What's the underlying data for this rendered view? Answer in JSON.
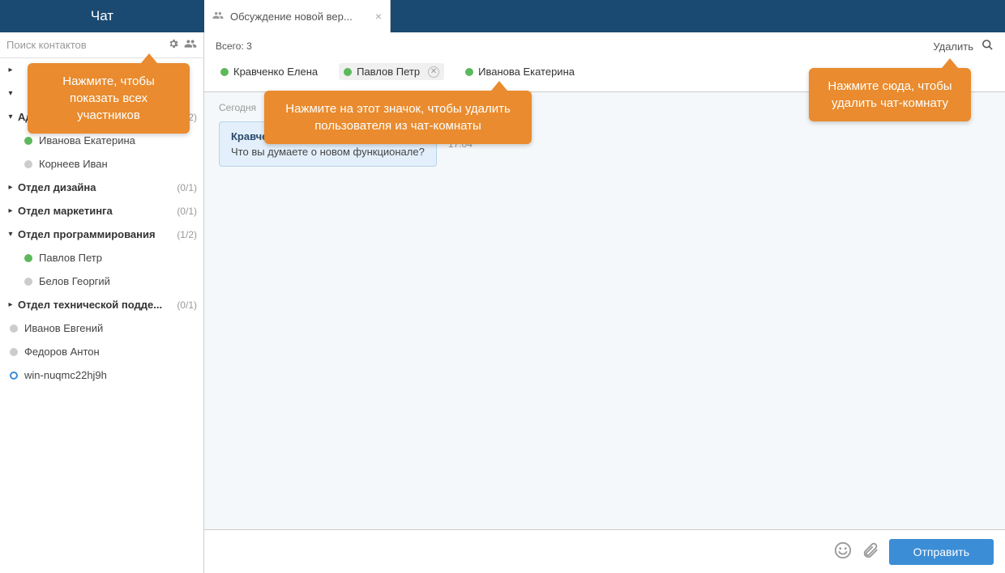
{
  "header": {
    "title": "Чат"
  },
  "tab": {
    "label": "Обсуждение новой вер..."
  },
  "search": {
    "placeholder": "Поиск контактов"
  },
  "tree": {
    "truncated_group": "...",
    "groups": [
      {
        "label": "Администрация",
        "count": "(1/2)",
        "expanded": true,
        "members": [
          {
            "name": "Иванова Екатерина",
            "status": "online"
          },
          {
            "name": "Корнеев Иван",
            "status": "offline"
          }
        ]
      },
      {
        "label": "Отдел дизайна",
        "count": "(0/1)",
        "expanded": false
      },
      {
        "label": "Отдел маркетинга",
        "count": "(0/1)",
        "expanded": false
      },
      {
        "label": "Отдел программирования",
        "count": "(1/2)",
        "expanded": true,
        "members": [
          {
            "name": "Павлов Петр",
            "status": "online"
          },
          {
            "name": "Белов Георгий",
            "status": "offline"
          }
        ]
      },
      {
        "label": "Отдел технической подде...",
        "count": "(0/1)",
        "expanded": false
      }
    ],
    "root_contacts": [
      {
        "name": "Иванов Евгений",
        "status": "offline"
      },
      {
        "name": "Федоров Антон",
        "status": "offline"
      },
      {
        "name": "win-nuqmc22hj9h",
        "status": "circle"
      }
    ]
  },
  "main": {
    "total_label": "Всего: 3",
    "delete_label": "Удалить",
    "participants": [
      {
        "name": "Кравченко Елена",
        "status": "online",
        "selected": false
      },
      {
        "name": "Павлов Петр",
        "status": "online",
        "selected": true
      },
      {
        "name": "Иванова Екатерина",
        "status": "online",
        "selected": false
      }
    ],
    "date": "Сегодня",
    "message": {
      "author": "Кравченко Елена",
      "text": "Что вы думаете о новом функционале?",
      "time": "17:04"
    },
    "send_label": "Отправить"
  },
  "callouts": {
    "c1": "Нажмите, чтобы показать всех участников",
    "c2": "Нажмите на этот значок, чтобы удалить пользователя из чат-комнаты",
    "c3": "Нажмите сюда, чтобы удалить чат-комнату"
  }
}
